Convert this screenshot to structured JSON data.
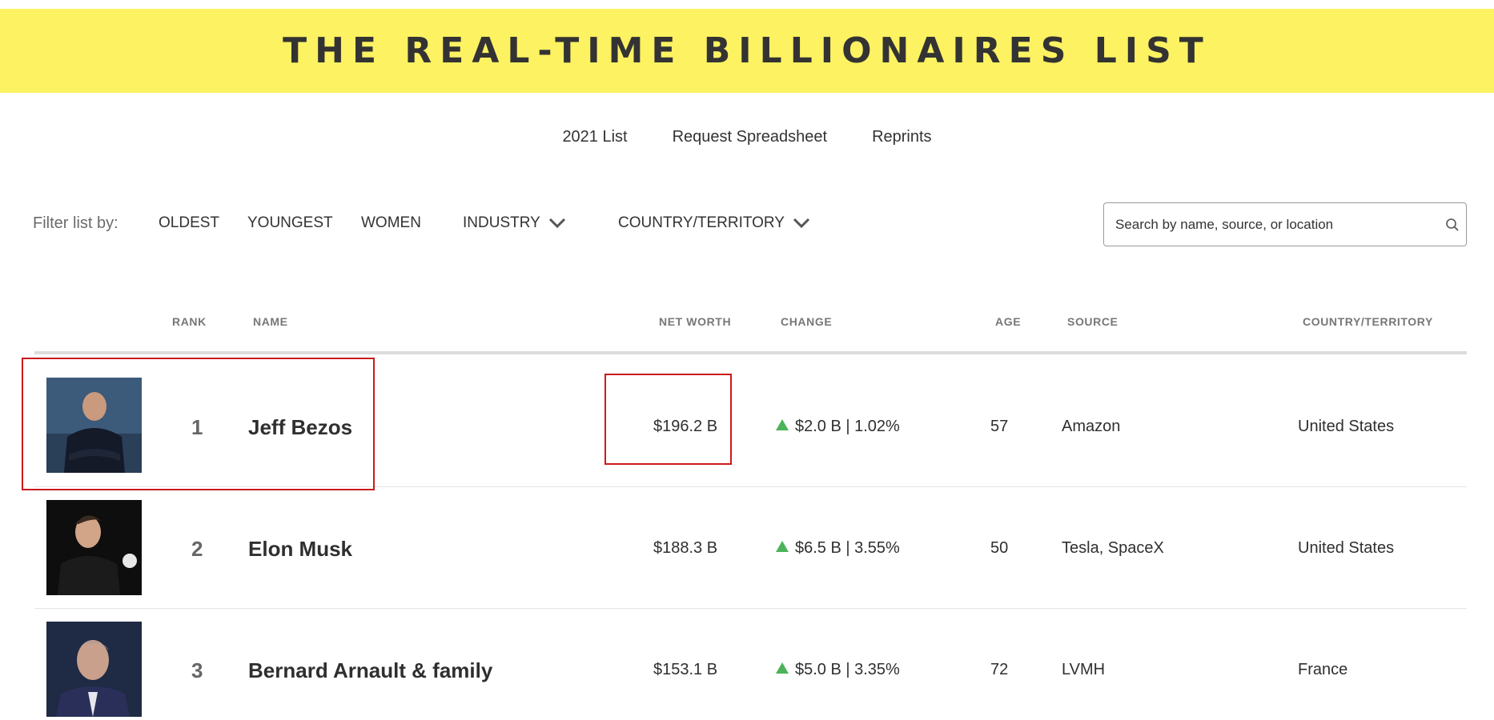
{
  "header": {
    "title": "THE REAL-TIME BILLIONAIRES LIST"
  },
  "subnav": [
    "2021 List",
    "Request Spreadsheet",
    "Reprints"
  ],
  "filters": {
    "label": "Filter list by:",
    "items": [
      "OLDEST",
      "YOUNGEST",
      "WOMEN",
      "INDUSTRY",
      "COUNTRY/TERRITORY"
    ]
  },
  "search": {
    "placeholder": "Search by name, source, or location"
  },
  "table": {
    "columns": [
      "RANK",
      "NAME",
      "NET WORTH",
      "CHANGE",
      "AGE",
      "SOURCE",
      "COUNTRY/TERRITORY"
    ],
    "rows": [
      {
        "rank": "1",
        "name": "Jeff Bezos",
        "net_worth": "$196.2 B",
        "change": "$2.0 B | 1.02%",
        "age": "57",
        "source": "Amazon",
        "country": "United States"
      },
      {
        "rank": "2",
        "name": "Elon Musk",
        "net_worth": "$188.3 B",
        "change": "$6.5 B | 3.55%",
        "age": "50",
        "source": "Tesla, SpaceX",
        "country": "United States"
      },
      {
        "rank": "3",
        "name": "Bernard Arnault & family",
        "net_worth": "$153.1 B",
        "change": "$5.0 B | 3.35%",
        "age": "72",
        "source": "LVMH",
        "country": "France"
      }
    ]
  },
  "colors": {
    "banner": "#fcf262",
    "up": "#4cb35a",
    "highlight": "#cc1a1a"
  }
}
